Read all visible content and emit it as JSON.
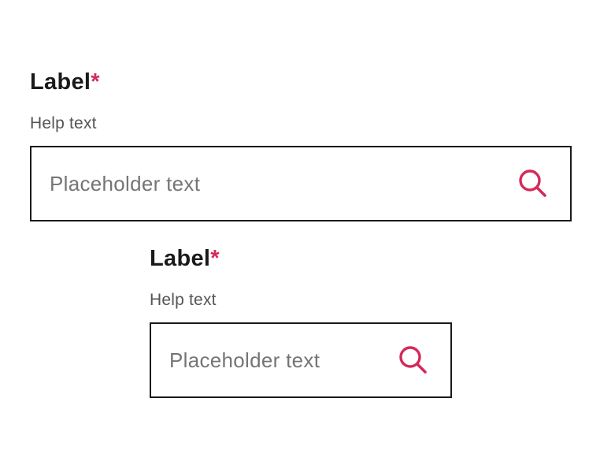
{
  "fields": [
    {
      "label": "Label",
      "required_marker": "*",
      "help_text": "Help text",
      "placeholder": "Placeholder text",
      "value": "",
      "icon": "search-icon"
    },
    {
      "label": "Label",
      "required_marker": "*",
      "help_text": "Help text",
      "placeholder": "Placeholder text",
      "value": "",
      "icon": "search-icon"
    }
  ],
  "colors": {
    "text": "#1a1a1a",
    "accent": "#d6295a",
    "help_text": "#555555",
    "placeholder": "#757575",
    "border": "#1a1a1a"
  }
}
